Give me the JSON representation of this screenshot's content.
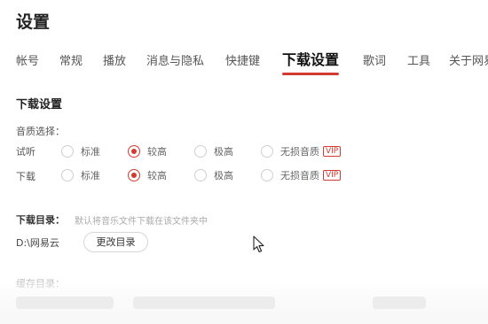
{
  "theme": {
    "accent": "#d33a31"
  },
  "header": {
    "title": "设置"
  },
  "tabs": [
    {
      "label": "帐号",
      "active": false
    },
    {
      "label": "常规",
      "active": false
    },
    {
      "label": "播放",
      "active": false
    },
    {
      "label": "消息与隐私",
      "active": false
    },
    {
      "label": "快捷键",
      "active": false
    },
    {
      "label": "下载设置",
      "active": true
    },
    {
      "label": "歌词",
      "active": false
    },
    {
      "label": "工具",
      "active": false
    },
    {
      "label": "关于网易",
      "active": false
    }
  ],
  "download_settings": {
    "title": "下载设置",
    "quality_label": "音质选择：",
    "rows": [
      {
        "label": "试听",
        "options": [
          {
            "label": "标准",
            "checked": false,
            "vip": false
          },
          {
            "label": "较高",
            "checked": true,
            "vip": false
          },
          {
            "label": "极高",
            "checked": false,
            "vip": false
          },
          {
            "label": "无损音质",
            "checked": false,
            "vip": true
          }
        ]
      },
      {
        "label": "下载",
        "options": [
          {
            "label": "标准",
            "checked": false,
            "vip": false
          },
          {
            "label": "较高",
            "checked": true,
            "vip": false
          },
          {
            "label": "极高",
            "checked": false,
            "vip": false
          },
          {
            "label": "无损音质",
            "checked": false,
            "vip": true
          }
        ]
      }
    ],
    "vip_badge": "VIP",
    "download_dir": {
      "label": "下载目录：",
      "hint": "默认将音乐文件下载在该文件夹中",
      "path": "D:\\网易云",
      "button": "更改目录"
    },
    "cache_dir_label": "缓存目录："
  }
}
